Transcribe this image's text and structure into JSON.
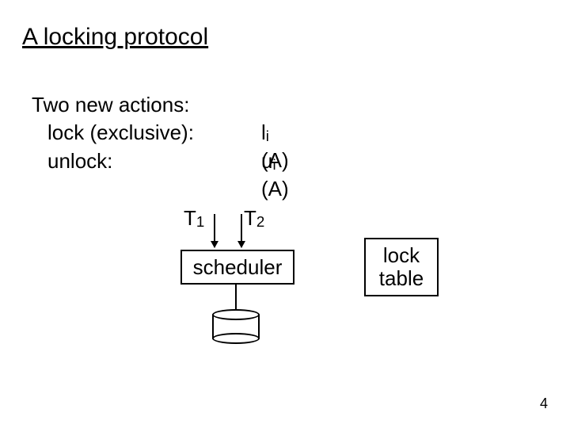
{
  "title": "A locking protocol",
  "intro": "Two new actions:",
  "rows": [
    {
      "label": "lock (exclusive):",
      "sym_prefix": "l",
      "sym_sub": "i",
      "sym_arg": " (A)"
    },
    {
      "label": "unlock:",
      "sym_prefix": "u",
      "sym_sub": "i",
      "sym_arg": " (A)"
    }
  ],
  "diagram": {
    "t1": {
      "prefix": "T",
      "sub": "1"
    },
    "t2": {
      "prefix": "T",
      "sub": "2"
    },
    "scheduler": "scheduler",
    "locktable_line1": "lock",
    "locktable_line2": "table"
  },
  "page": "4"
}
